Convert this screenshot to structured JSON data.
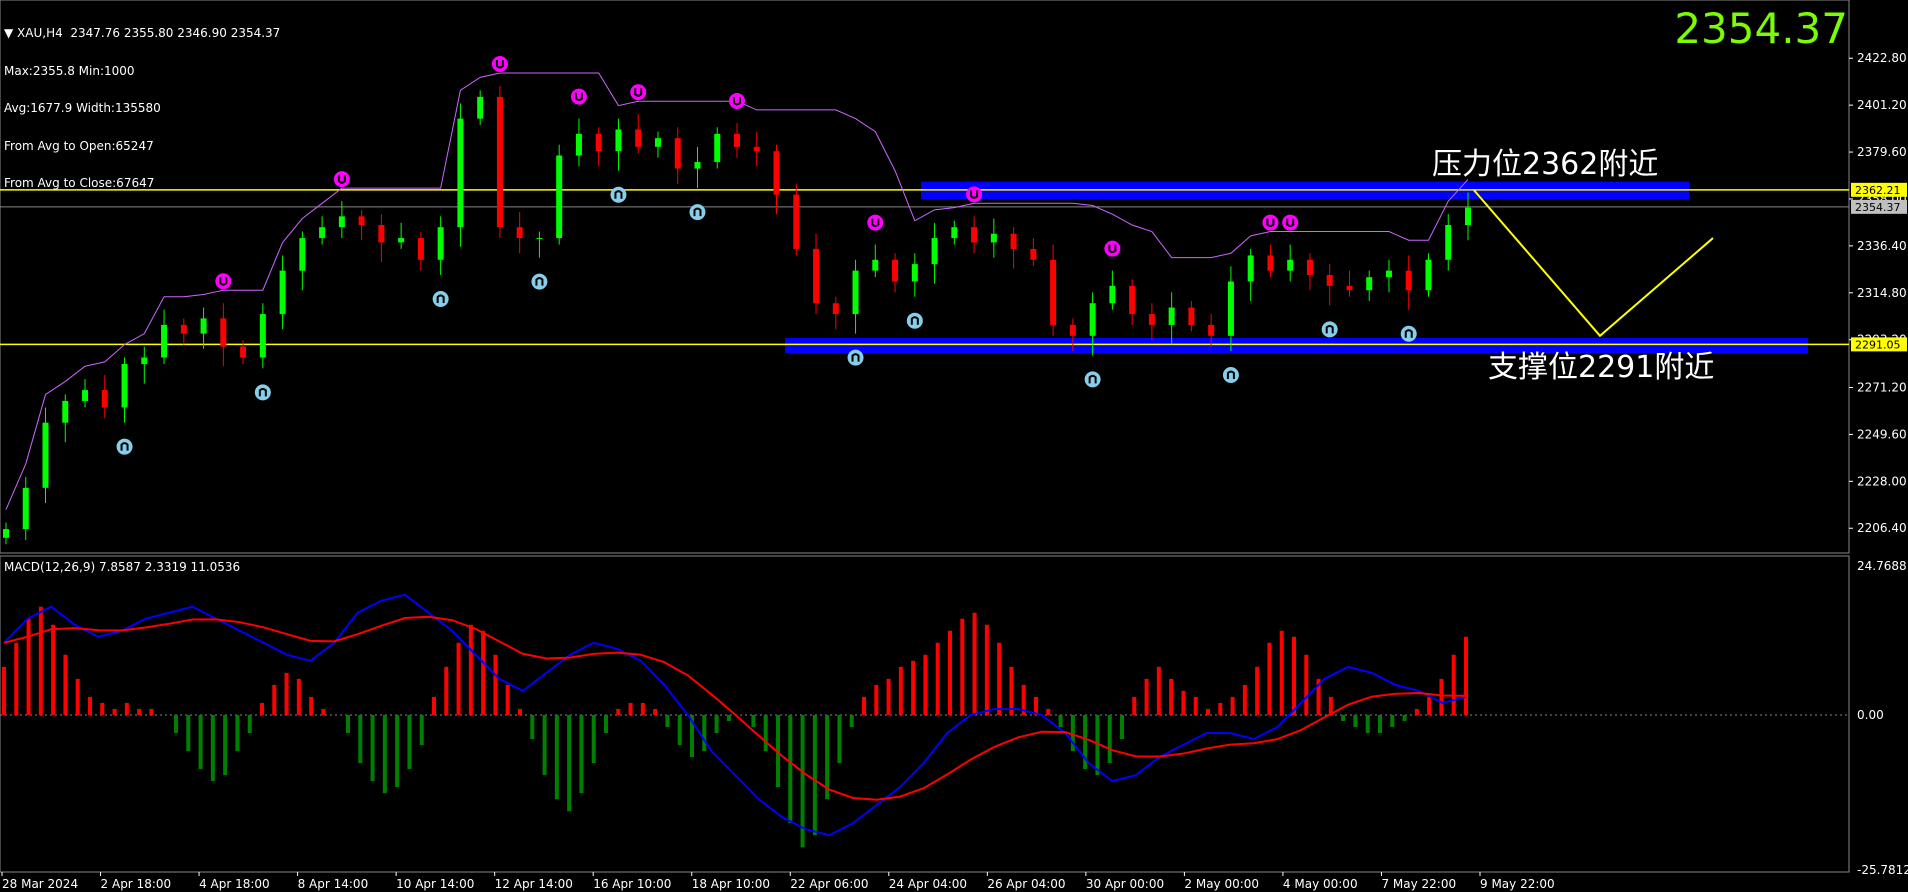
{
  "window": {
    "symbol": "XAU,H4",
    "ohlc": "2347.76 2355.80 2346.90 2354.37"
  },
  "info_lines": [
    "Max:2355.8 Min:1000",
    "Avg:1677.9 Width:135580",
    "From Avg to Open:65247",
    "From Avg to Close:67647"
  ],
  "big_price": "2354.37",
  "annotations": {
    "resistance": "压力位2362附近",
    "support": "支撑位2291附近"
  },
  "price_axis": {
    "ticks": [
      "2422.80",
      "2401.20",
      "2379.60",
      "2358.00",
      "2336.40",
      "2314.80",
      "2293.20",
      "2271.20",
      "2249.60",
      "2228.00",
      "2206.40"
    ],
    "tags": [
      {
        "text": "2362.21",
        "value": 2362.21,
        "bg": "#FFFF00",
        "fg": "#000000"
      },
      {
        "text": "2354.37",
        "value": 2354.37,
        "bg": "#C0C0C0",
        "fg": "#000000"
      },
      {
        "text": "2291.05",
        "value": 2291.05,
        "bg": "#FFFF00",
        "fg": "#000000"
      }
    ]
  },
  "macd": {
    "title": "MACD(12,26,9) 7.8587 2.3319 11.0536",
    "ticks": [
      "24.7688",
      "0.00",
      "-25.7812"
    ]
  },
  "time_axis": [
    "28 Mar 2024",
    "2 Apr 18:00",
    "4 Apr 18:00",
    "8 Apr 14:00",
    "10 Apr 14:00",
    "12 Apr 14:00",
    "16 Apr 10:00",
    "18 Apr 10:00",
    "22 Apr 06:00",
    "24 Apr 04:00",
    "26 Apr 04:00",
    "30 Apr 00:00",
    "2 May 00:00",
    "4 May 00:00",
    "7 May 22:00",
    "9 May 22:00"
  ],
  "colors": {
    "background": "#000000",
    "bull_candle": "#00FF00",
    "bear_candle": "#FF0000",
    "level_line": "#FFFF00",
    "zone": "#0000FF",
    "channel": "#CC66FF",
    "macd_fast": "#0000FF",
    "macd_signal": "#FF0000",
    "hist_pos": "#FF0000",
    "hist_neg": "#008000",
    "fractal_up": "#FF00FF",
    "fractal_down": "#87CEEB",
    "big_price": "#7CFC00"
  },
  "chart_data": {
    "type": "candlestick",
    "symbol": "XAU",
    "timeframe": "H4",
    "levels": {
      "resistance": 2362.21,
      "support": 2291.05,
      "last": 2354.37
    },
    "price_range": [
      2195,
      2445
    ],
    "close_path": [
      2206,
      2225,
      2255,
      2265,
      2270,
      2262,
      2282,
      2285,
      2300,
      2296,
      2303,
      2290,
      2285,
      2305,
      2325,
      2340,
      2345,
      2350,
      2346,
      2338,
      2340,
      2330,
      2345,
      2395,
      2405,
      2345,
      2340,
      2340,
      2378,
      2388,
      2380,
      2390,
      2382,
      2386,
      2372,
      2375,
      2388,
      2382,
      2380,
      2360,
      2335,
      2310,
      2305,
      2325,
      2330,
      2320,
      2328,
      2340,
      2345,
      2338,
      2342,
      2335,
      2330,
      2300,
      2295,
      2310,
      2318,
      2305,
      2300,
      2308,
      2300,
      2295,
      2320,
      2332,
      2325,
      2330,
      2323,
      2318,
      2316,
      2322,
      2325,
      2316,
      2330,
      2346,
      2354
    ],
    "projection": [
      [
        2362,
        2295
      ],
      [
        2295,
        2340
      ]
    ],
    "macd_range": [
      -25.7812,
      24.7688
    ],
    "histogram": [
      8,
      12,
      16,
      18,
      15,
      10,
      6,
      3,
      2,
      1,
      2,
      1,
      1,
      0,
      -3,
      -6,
      -9,
      -11,
      -10,
      -6,
      -3,
      2,
      5,
      7,
      6,
      3,
      1,
      0,
      -3,
      -8,
      -11,
      -13,
      -12,
      -9,
      -5,
      3,
      8,
      12,
      15,
      14,
      10,
      5,
      1,
      -4,
      -10,
      -14,
      -16,
      -13,
      -8,
      -3,
      1,
      2,
      2,
      1,
      -2,
      -5,
      -7,
      -6,
      -3,
      -1,
      0,
      -2,
      -6,
      -12,
      -18,
      -22,
      -20,
      -14,
      -8,
      -2,
      3,
      5,
      6,
      8,
      9,
      10,
      12,
      14,
      16,
      17,
      15,
      12,
      8,
      5,
      3,
      1,
      -2,
      -6,
      -9,
      -10,
      -8,
      -4,
      3,
      6,
      8,
      6,
      4,
      3,
      1,
      2,
      3,
      5,
      8,
      12,
      14,
      13,
      10,
      6,
      3,
      -1,
      -2,
      -3,
      -3,
      -2,
      -1,
      1,
      3,
      6,
      10,
      13
    ]
  }
}
